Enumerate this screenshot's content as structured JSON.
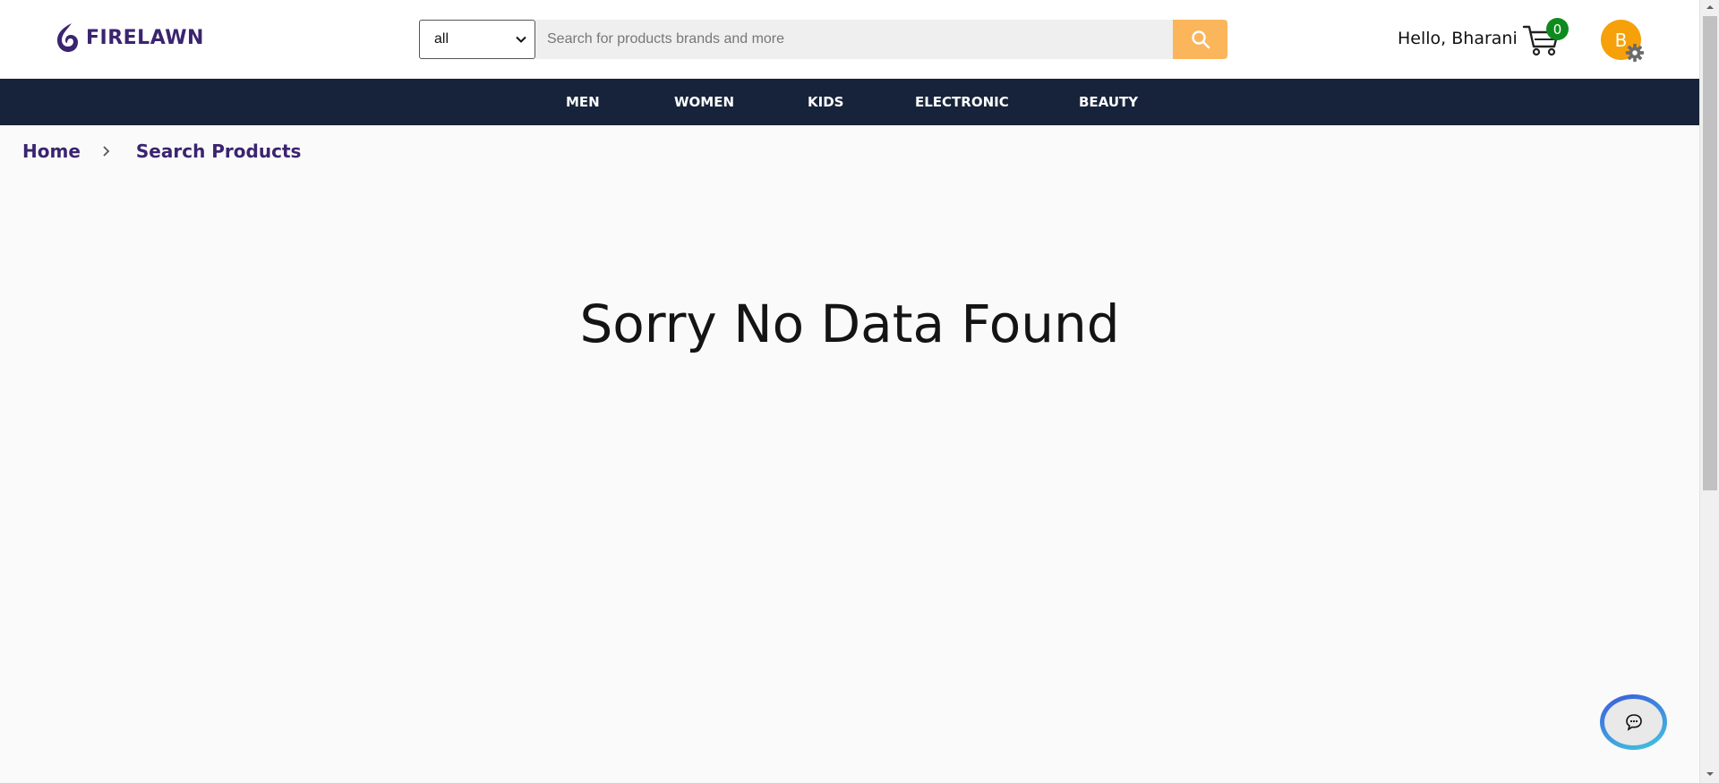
{
  "header": {
    "logo_text": "FIRELAWN",
    "search": {
      "category_value": "all",
      "placeholder": "Search for products brands and more"
    },
    "greeting": "Hello, Bharani",
    "cart_count": "0",
    "avatar_initial": "B"
  },
  "nav": {
    "items": [
      "MEN",
      "WOMEN",
      "KIDS",
      "ELECTRONIC",
      "BEAUTY"
    ]
  },
  "breadcrumb": {
    "home": "Home",
    "current": "Search Products"
  },
  "main": {
    "message": "Sorry No Data Found"
  },
  "colors": {
    "brand": "#3b2470",
    "navbar": "#17233a",
    "search_button": "#fbb55b",
    "cart_badge": "#0f8a1f",
    "avatar": "#f6a00a"
  },
  "icons": [
    "logo-mark-icon",
    "chevron-down-icon",
    "search-icon",
    "cart-icon",
    "gear-icon",
    "chevron-right-icon",
    "chat-icon"
  ]
}
